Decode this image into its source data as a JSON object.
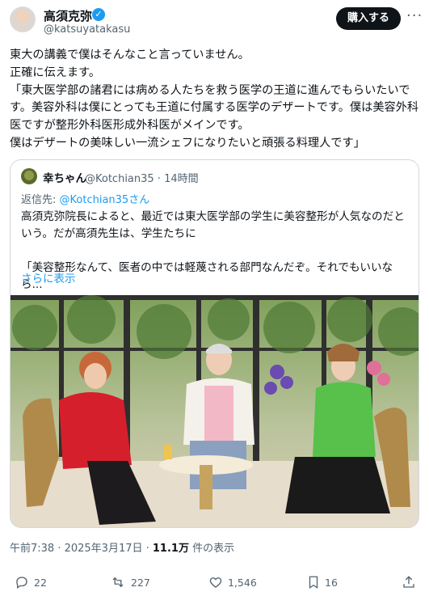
{
  "author": {
    "name": "高須克弥",
    "handle": "@katsuyatakasu",
    "verified_mark": "✓"
  },
  "buttons": {
    "buy": "購入する",
    "more": "···"
  },
  "tweet": {
    "text": "東大の講義で僕はそんなこと言っていません。\n正確に伝えます。\n「東大医学部の諸君には病める人たちを救う医学の王道に進んでもらいたいです。美容外科は僕にとっても王道に付属する医学のデザートです。僕は美容外科医ですが整形外科医形成外科医がメインです。\n僕はデザートの美味しい一流シェフになりたいと頑張る料理人です」"
  },
  "quote": {
    "name": "幸ちゃん",
    "handle_time": "@Kotchian35 · 14時間",
    "reply_prefix": "返信先:",
    "reply_to": "@Kotchian35さん",
    "text": "高須克弥院長によると、最近では東大医学部の学生に美容整形が人気なのだという。だが高須先生は、学生たちに\n\n「美容整形なんて、医者の中では軽蔑される部門なんだぞ。それでもいいなら...",
    "show_more": "さらに表示"
  },
  "meta": {
    "timestamp": "午前7:38 · 2025年3月17日 · ",
    "views": "11.1万",
    "views_suffix": " 件の表示"
  },
  "actions": {
    "replies": "22",
    "reposts": "227",
    "likes": "1,546",
    "bookmarks": "16"
  },
  "icons": [
    "verified-badge-icon",
    "more-icon",
    "reply-icon",
    "repost-icon",
    "like-icon",
    "bookmark-icon",
    "share-icon"
  ],
  "colors": {
    "accent": "#1d9bf0",
    "text": "#0f1419",
    "secondary": "#536471"
  }
}
